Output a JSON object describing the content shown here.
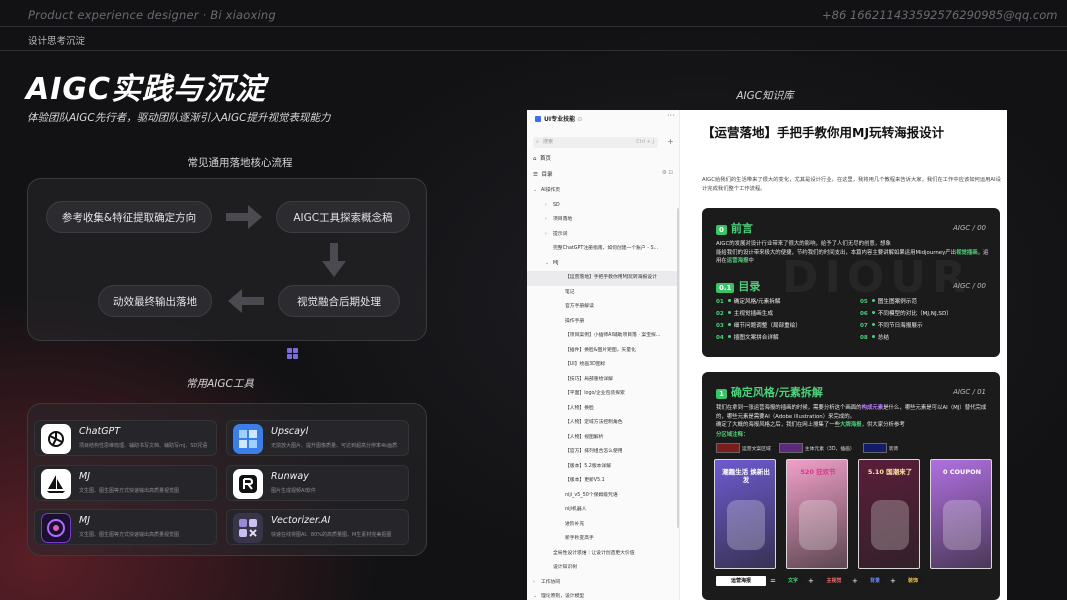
{
  "header": {
    "role": "Product experience designer · Bi xiaoxing",
    "phone": "+86 16621143359",
    "email": "2576290985@qq.com",
    "section": "设计思考沉淀"
  },
  "title": "AIGC实践与沉淀",
  "subtitle": "体验团队AIGC先行者，驱动团队逐渐引入AIGC提升视觉表现能力",
  "flow": {
    "title": "常见通用落地核心流程",
    "steps": [
      "参考收集&特征提取确定方向",
      "AIGC工具探索概念稿",
      "视觉融合后期处理",
      "动效最终输出落地"
    ]
  },
  "tools": {
    "title": "常用AIGC工具",
    "items": [
      {
        "name": "ChatGPT",
        "desc": "项目结构性思维梳理、辅助书写文档、辅助写mj、SD咒语",
        "icon": "openai-icon"
      },
      {
        "name": "Upscayl",
        "desc": "无损放大图片、提升图像质量、可达到超高分辨率4k画质",
        "icon": "upscayl-icon"
      },
      {
        "name": "MJ",
        "desc": "文生图、图生图等方式快速输出高质量视觉图",
        "icon": "midjourney-icon"
      },
      {
        "name": "Runway",
        "desc": "图片生成视频AI软件",
        "icon": "runway-icon"
      },
      {
        "name": "MJ",
        "desc": "文生图、图生图等方式快速输出高质量视觉图",
        "icon": "stable-diffusion-icon"
      },
      {
        "name": "Vectorizer.AI",
        "desc": "快速在线将图AI、80%的高质量图、M生素材完美抠图",
        "icon": "vectorizer-icon"
      }
    ]
  },
  "kb_title": "AIGC知识库",
  "app": {
    "workspace": "UI专业技能",
    "search_placeholder": "搜索",
    "search_shortcut": "Ctrl + J",
    "nav_home": "首页",
    "nav_toc": "目录",
    "tree": [
      {
        "label": "AI操作页",
        "level": 0,
        "arrow": "⌄"
      },
      {
        "label": "SD",
        "level": 1,
        "arrow": "›"
      },
      {
        "label": "项目落地",
        "level": 1,
        "arrow": "›"
      },
      {
        "label": "提示词",
        "level": 1,
        "arrow": "›"
      },
      {
        "label": "完整ChatGPT注册指南，如何创建一个账户 - S...",
        "level": 1,
        "arrow": ""
      },
      {
        "label": "MJ",
        "level": 1,
        "arrow": "⌄"
      },
      {
        "label": "【运营落地】手把手教你用MJ玩转海报设计",
        "level": 2,
        "arrow": "",
        "selected": true
      },
      {
        "label": "笔记",
        "level": 2,
        "arrow": ""
      },
      {
        "label": "官方手册解读",
        "level": 2,
        "arrow": ""
      },
      {
        "label": "操作手册",
        "level": 2,
        "arrow": ""
      },
      {
        "label": "【项目案例】小插师AI辅助项目落 · 案宝探...",
        "level": 2,
        "arrow": ""
      },
      {
        "label": "【插件】换脸&图片矩图，矢量化",
        "level": 2,
        "arrow": ""
      },
      {
        "label": "【UI】绘画3D图标",
        "level": 2,
        "arrow": ""
      },
      {
        "label": "【技巧】局部重绘详解",
        "level": 2,
        "arrow": ""
      },
      {
        "label": "【平面】logo/企业包装探索",
        "level": 2,
        "arrow": ""
      },
      {
        "label": "【人物】换脸",
        "level": 2,
        "arrow": ""
      },
      {
        "label": "【人物】定域方法控制角色",
        "level": 2,
        "arrow": ""
      },
      {
        "label": "【人物】视图解析",
        "level": 2,
        "arrow": ""
      },
      {
        "label": "【官方】排列组合怎么使用",
        "level": 2,
        "arrow": ""
      },
      {
        "label": "【版本】5.2版本详解",
        "level": 2,
        "arrow": ""
      },
      {
        "label": "【版本】更新V5.1",
        "level": 2,
        "arrow": ""
      },
      {
        "label": "niji_v5_50个保姆级咒语",
        "level": 2,
        "arrow": ""
      },
      {
        "label": "niji机器人",
        "level": 2,
        "arrow": ""
      },
      {
        "label": "进阶补充",
        "level": 2,
        "arrow": ""
      },
      {
        "label": "新手秒变高手",
        "level": 2,
        "arrow": ""
      },
      {
        "label": "全局性设计思维｜让设计创造更大价值",
        "level": 1,
        "arrow": ""
      },
      {
        "label": "设计知识树",
        "level": 1,
        "arrow": ""
      },
      {
        "label": "工作协同",
        "level": 0,
        "arrow": "›"
      },
      {
        "label": "理论原则，设计模型",
        "level": 0,
        "arrow": "⌄"
      }
    ],
    "doc": {
      "title": "【运营落地】手把手教你用MJ玩转海报设计",
      "intro": "AIGC给我们的生活带来了很大的变化，尤其是设计行业，在这里，我将用几个教程来告诉大家，我们在工作中应该如何运用AI设计完成我们整个工作流程。",
      "preface": {
        "badge": "0",
        "heading": "前言",
        "tag": "AIGC / 00",
        "body_a": "AIGC的发展对设计行业带来了很大的影响，给予了人们无尽的创意，想象",
        "body_b": "能给我们的设计带来极大的便捷，节约我们的时间支出，本篇内容主要讲解如果运用Midjourney产出",
        "body_hl1": "视觉插画",
        "body_c": "，运用在",
        "body_hl2": "运营海报",
        "body_d": "中"
      },
      "toc": {
        "badge": "0.1",
        "heading": "目录",
        "tag": "AIGC / 00",
        "items": [
          {
            "no": "01",
            "text": "确定风格/元素拆解"
          },
          {
            "no": "02",
            "text": "主视觉插画生成"
          },
          {
            "no": "03",
            "text": "细节问题调整（局部重绘）"
          },
          {
            "no": "04",
            "text": "插图文案拼合详解"
          },
          {
            "no": "05",
            "text": "图生图案例示范"
          },
          {
            "no": "06",
            "text": "不同模型的对比（MJ,NJ,SD）"
          },
          {
            "no": "07",
            "text": "不同节日海报展示"
          },
          {
            "no": "08",
            "text": "总结"
          }
        ]
      },
      "watermark": "DIOUR",
      "section1": {
        "badge": "1",
        "heading": "确定风格/元素拆解",
        "tag": "AIGC / 01",
        "body_a": "我们在拿到一张运营海报的插画的时候，需要分析这个画面的",
        "body_hl1": "构成元素",
        "body_b": "是什么，哪些元素是可以AI（MJ）替代完成的，哪些元素是需要AI（Adobe Illustration）来完成的。",
        "body_c": "确定了大概的海报风格之后，我们在网上搜集了一些",
        "body_hl2": "大牌海报",
        "body_d": "，供大家分析参考",
        "legend_title": "分区域注释：",
        "legend": [
          {
            "label": "运营文案区域",
            "color": "#7a1d1d"
          },
          {
            "label": "主体元素（3D，插画）",
            "color": "#5b2a7a"
          },
          {
            "label": "装饰",
            "color": "#141c6a"
          }
        ],
        "posters": [
          {
            "text": "潮趣生活 焕新出发",
            "bg": "#6e5ad0",
            "fg": "#ffffff"
          },
          {
            "text": "520 狂欢节",
            "bg": "#f0a0c8",
            "fg": "#d43a8a"
          },
          {
            "text": "5.10 国潮来了",
            "bg": "#5a1e3a",
            "fg": "#ffe3a0"
          },
          {
            "text": "0 COUPON",
            "bg": "#b070e0",
            "fg": "#ffffff"
          }
        ],
        "formula": [
          {
            "text": "运营海报",
            "bg": "#ffffff",
            "fg": "#111111"
          },
          {
            "text": "文字",
            "bg": "#1a1a1a",
            "fg": "#4cd07a"
          },
          {
            "text": "主视觉",
            "bg": "#1a1a1a",
            "fg": "#ff6b6b"
          },
          {
            "text": "背景",
            "bg": "#1a1a1a",
            "fg": "#6b8bff"
          },
          {
            "text": "装饰",
            "bg": "#1a1a1a",
            "fg": "#f0c040"
          }
        ],
        "ops": [
          "=",
          "+",
          "+",
          "+"
        ]
      }
    }
  }
}
